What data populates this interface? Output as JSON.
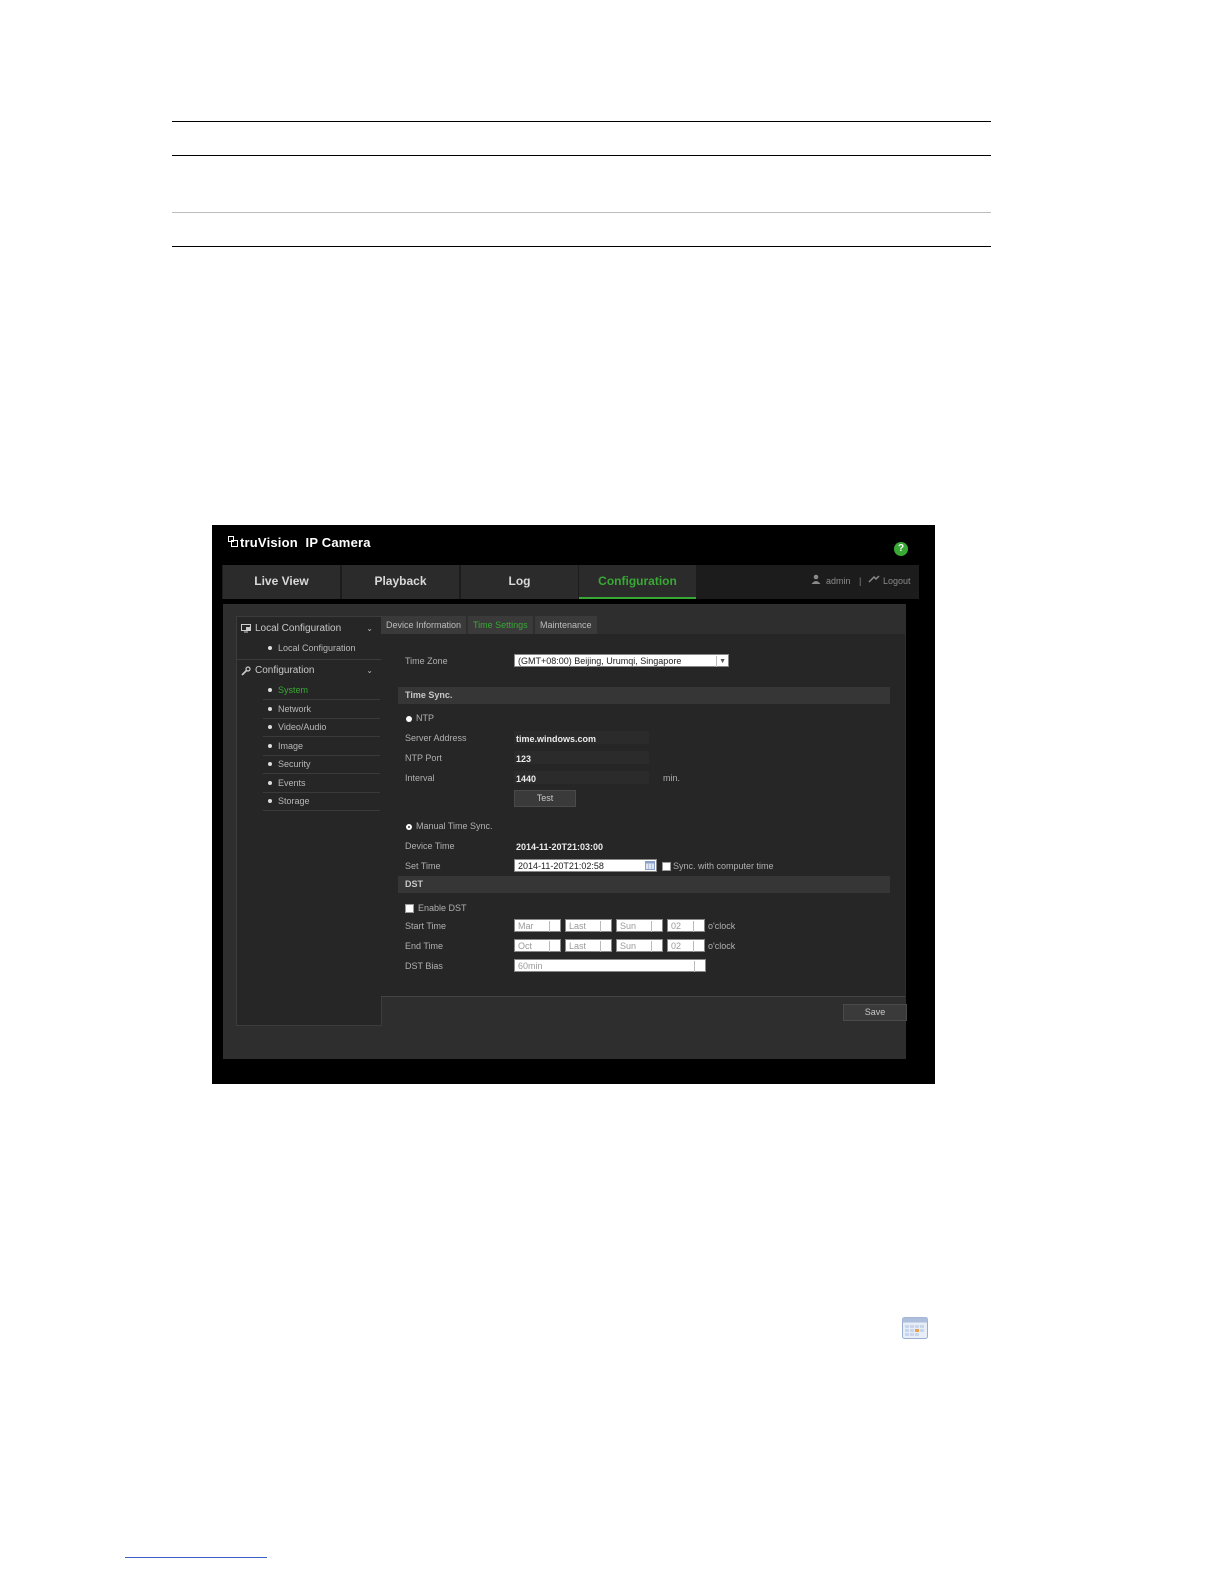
{
  "app": {
    "brand": "truVision",
    "product": "IP Camera",
    "help_icon": "?"
  },
  "nav": {
    "tabs": [
      "Live View",
      "Playback",
      "Log",
      "Configuration"
    ],
    "active": "Configuration",
    "user": "admin",
    "divider": "|",
    "logout": "Logout",
    "accent": "#39a935"
  },
  "sidebar": {
    "local_header": "Local Configuration",
    "local_items": [
      "Local Configuration"
    ],
    "config_header": "Configuration",
    "config_items": [
      "System",
      "Network",
      "Video/Audio",
      "Image",
      "Security",
      "Events",
      "Storage"
    ],
    "active_item": "System"
  },
  "subtabs": [
    "Device Information",
    "Time Settings",
    "Maintenance"
  ],
  "form": {
    "time_zone_label": "Time Zone",
    "time_zone_value": "(GMT+08:00) Beijing, Urumqi, Singapore",
    "time_sync_header": "Time Sync.",
    "ntp_label": "NTP",
    "server_address_label": "Server Address",
    "server_address_value": "time.windows.com",
    "ntp_port_label": "NTP Port",
    "ntp_port_value": "123",
    "interval_label": "Interval",
    "interval_value": "1440",
    "interval_unit": "min.",
    "test_button": "Test",
    "manual_label": "Manual Time Sync.",
    "device_time_label": "Device Time",
    "device_time_value": "2014-11-20T21:03:00",
    "set_time_label": "Set Time",
    "set_time_value": "2014-11-20T21:02:58",
    "sync_label": "Sync. with computer time",
    "dst_header": "DST",
    "enable_dst_label": "Enable DST",
    "start_time_label": "Start Time",
    "start": {
      "month": "Mar",
      "week": "Last",
      "day": "Sun",
      "hour": "02"
    },
    "end_time_label": "End Time",
    "end": {
      "month": "Oct",
      "week": "Last",
      "day": "Sun",
      "hour": "02"
    },
    "oclock": "o'clock",
    "dst_bias_label": "DST Bias",
    "dst_bias_value": "60min",
    "save_button": "Save"
  }
}
